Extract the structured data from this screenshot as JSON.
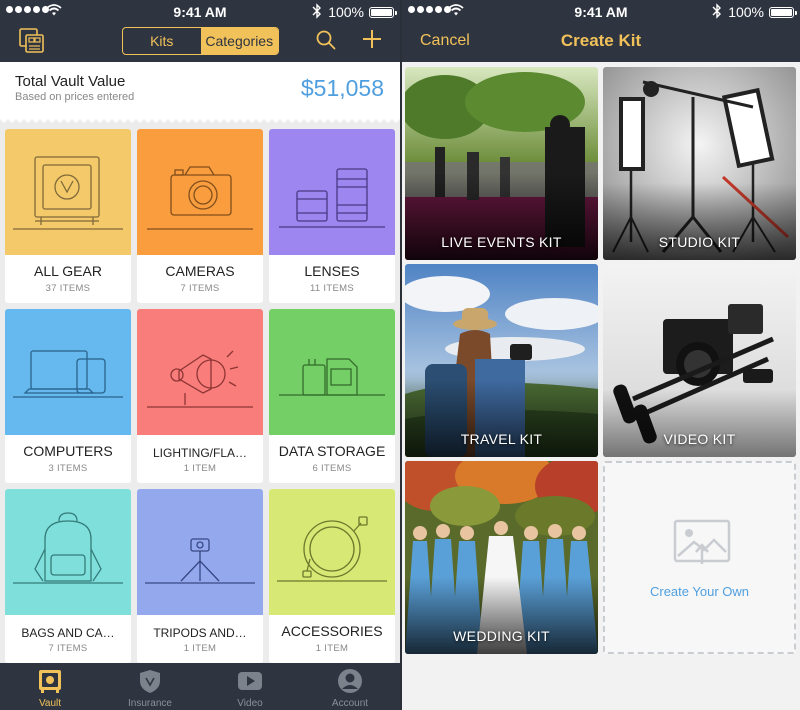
{
  "status": {
    "time": "9:41 AM",
    "battery": "100%"
  },
  "left": {
    "segments": {
      "kits": "Kits",
      "categories": "Categories",
      "selected": "Categories"
    },
    "vault": {
      "title": "Total Vault Value",
      "subtitle": "Based on prices entered",
      "amount": "$51,058"
    },
    "categories": [
      {
        "name": "ALL GEAR",
        "count": "37 ITEMS",
        "color": "#f4c96a",
        "icon": "vault-icon"
      },
      {
        "name": "CAMERAS",
        "count": "7 ITEMS",
        "color": "#f99d3f",
        "icon": "camera-icon"
      },
      {
        "name": "LENSES",
        "count": "11 ITEMS",
        "color": "#9e86f0",
        "icon": "lens-icon"
      },
      {
        "name": "COMPUTERS",
        "count": "3 ITEMS",
        "color": "#66b9ef",
        "icon": "computer-icon"
      },
      {
        "name": "LIGHTING/FLA…",
        "count": "1 ITEM",
        "color": "#f97d7b",
        "icon": "light-icon"
      },
      {
        "name": "DATA STORAGE",
        "count": "6 ITEMS",
        "color": "#74cf66",
        "icon": "storage-icon"
      },
      {
        "name": "BAGS AND CA…",
        "count": "7 ITEMS",
        "color": "#7fdfdb",
        "icon": "backpack-icon"
      },
      {
        "name": "TRIPODS AND…",
        "count": "1 ITEM",
        "color": "#94a8ee",
        "icon": "tripod-icon"
      },
      {
        "name": "ACCESSORIES",
        "count": "1 ITEM",
        "color": "#d7e874",
        "icon": "cable-icon"
      }
    ],
    "tabs": [
      {
        "label": "Vault",
        "icon": "vault-tab-icon",
        "active": true
      },
      {
        "label": "Insurance",
        "icon": "shield-icon",
        "active": false
      },
      {
        "label": "Video",
        "icon": "play-icon",
        "active": false
      },
      {
        "label": "Account",
        "icon": "user-icon",
        "active": false
      }
    ]
  },
  "right": {
    "cancel": "Cancel",
    "title": "Create Kit",
    "kits": [
      {
        "label": "LIVE EVENTS KIT",
        "image": "concert-photo"
      },
      {
        "label": "STUDIO KIT",
        "image": "studio-lights-photo"
      },
      {
        "label": "TRAVEL KIT",
        "image": "travel-photographer-photo"
      },
      {
        "label": "VIDEO KIT",
        "image": "video-rig-photo"
      },
      {
        "label": "WEDDING KIT",
        "image": "bridal-party-photo"
      }
    ],
    "create_own": "Create Your Own"
  },
  "colors": {
    "accent": "#f1c15a",
    "bar": "#2f3540",
    "link": "#4f9fe0"
  }
}
